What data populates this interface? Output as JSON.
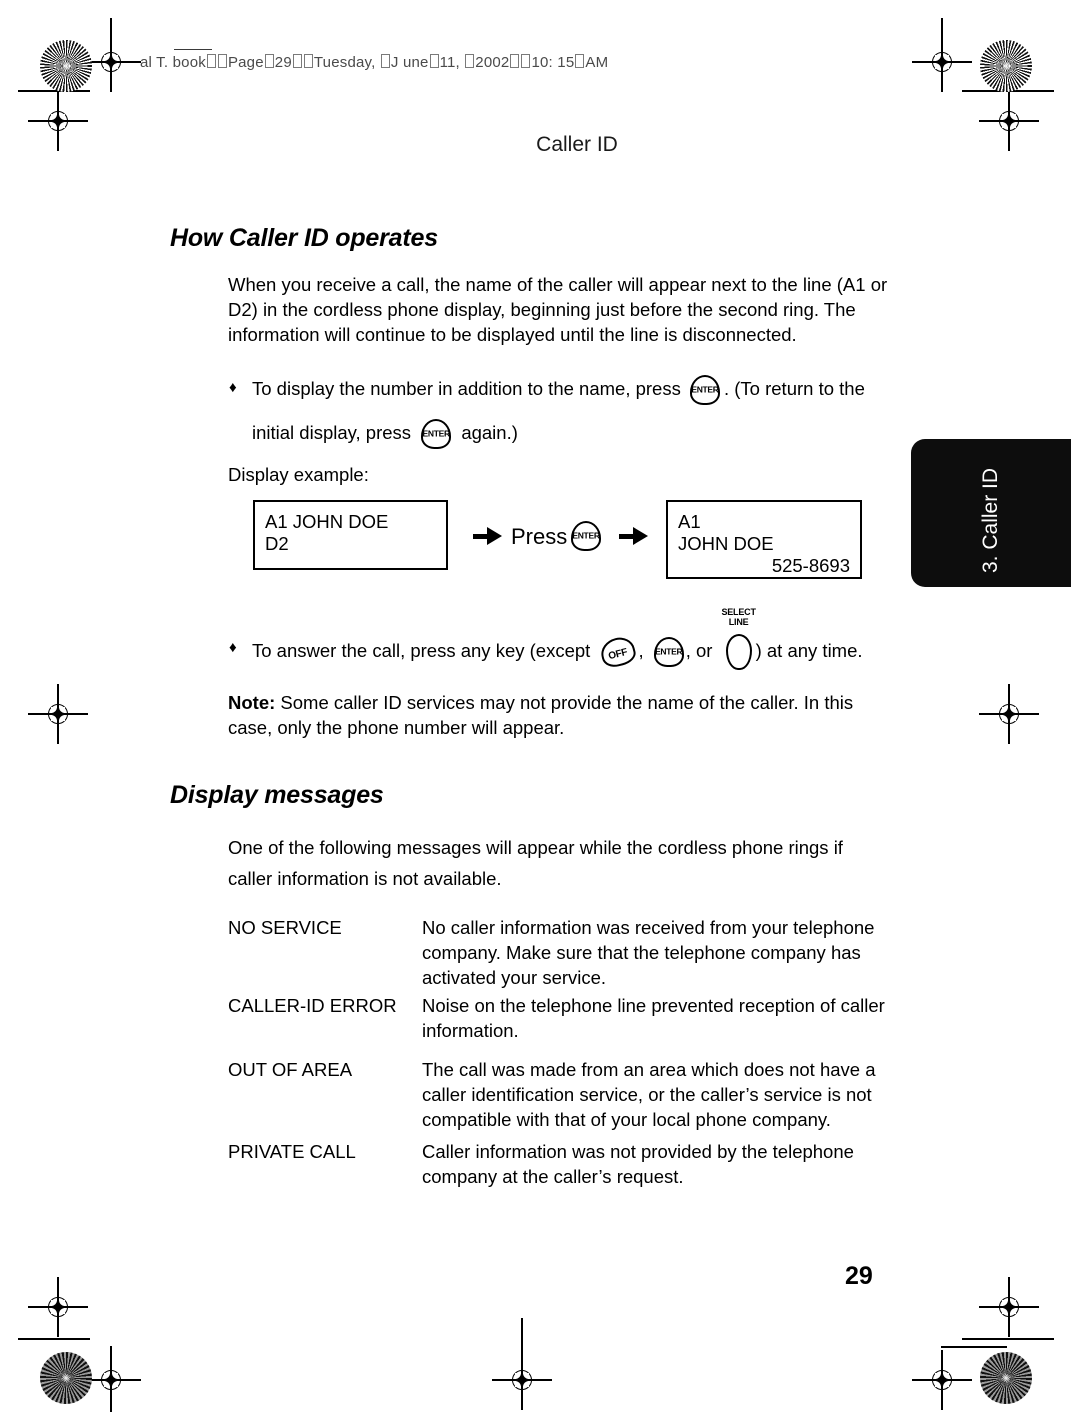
{
  "file_header": {
    "prefix": "al T. book",
    "segments": [
      "Page",
      "29",
      "Tuesday,",
      "J une",
      "11,",
      "2002",
      "10: 15",
      "AM"
    ],
    "full_text": "al T. book□□Page□29□□Tuesday, □J une□11, □2002□□10: 15□AM"
  },
  "running_head": "Caller ID",
  "side_tab": {
    "label": "3. Caller ID",
    "color": "#0d0d0d"
  },
  "page_number": "29",
  "sections": [
    {
      "heading": "How Caller ID operates",
      "intro": "When you receive a call, the name of the caller will appear next to the line (A1 or D2) in the cordless phone display, beginning just before the second ring. The information will continue to be displayed until the line is disconnected."
    },
    {
      "heading": "Display messages",
      "intro": "One of the following messages will appear while the cordless phone rings if caller information is not available."
    }
  ],
  "bullets": {
    "b1_part1": "To display the number in addition to the name, press",
    "b1_part2": ". (To return to the",
    "b1_part3": "initial display, press",
    "b1_part4": "again.)",
    "b2_part1": "To answer the call, press any key (except",
    "b2_comma1": ",",
    "b2_comma2": ", or",
    "b2_part2": ") at any time.",
    "marker": "♦"
  },
  "display_example": {
    "caption": "Display example:",
    "press_label": "Press",
    "before": {
      "line1": "A1 JOHN DOE",
      "line2": "D2"
    },
    "after": {
      "line1": "A1",
      "line2": "JOHN DOE",
      "line3": "525-8693"
    }
  },
  "note": {
    "label": "Note:",
    "text": " Some caller ID services may not provide the name of the caller. In this case, only the phone number will appear."
  },
  "keys": {
    "enter": "ENTER",
    "off": "OFF",
    "off_icon": "phone-handset-icon",
    "select_line_1": "SELECT",
    "select_line_2": "LINE"
  },
  "messages": [
    {
      "term": "NO SERVICE",
      "description": "No caller information was received from your telephone company. Make sure that the telephone company has activated your service."
    },
    {
      "term": "CALLER-ID ERROR",
      "description": "Noise on the telephone line prevented reception of caller information."
    },
    {
      "term": "OUT OF AREA",
      "description": "The call was made from an area which does not have a caller identification service, or the caller’s service is not compatible with that of your local phone company."
    },
    {
      "term": "PRIVATE CALL",
      "description": "Caller information was not provided by the telephone company at the caller’s request."
    }
  ]
}
